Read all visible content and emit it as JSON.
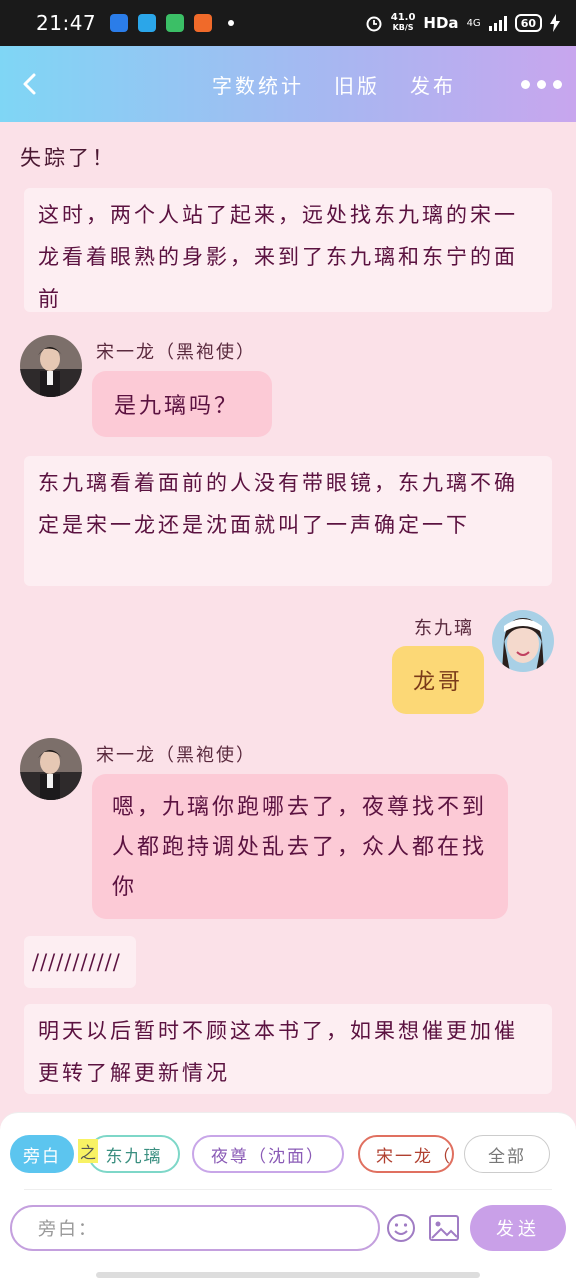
{
  "status_bar": {
    "time": "21:47",
    "net_speed": "41.0",
    "net_unit": "KB/S",
    "hd": "HDa",
    "network": "4G",
    "battery": "60"
  },
  "header": {
    "actions": [
      "字数统计",
      "旧版",
      "发布"
    ]
  },
  "messages": {
    "m0": "失踪了！",
    "m1": "这时，两个人站了起来，远处找东九璃的宋一龙看着眼熟的身影，来到了东九璃和东宁的面前",
    "m2_speaker": "宋一龙（黑袍使）",
    "m2_text": "是九璃吗？",
    "m3": "东九璃看着面前的人没有带眼镜，东九璃不确定是宋一龙还是沈面就叫了一声确定一下",
    "m4_speaker": "东九璃",
    "m4_text": "龙哥",
    "m5_speaker": "宋一龙（黑袍使）",
    "m5_text": "嗯，九璃你跑哪去了，夜尊找不到人都跑持调处乱去了，众人都在找你",
    "m6": "///////////",
    "m7": "明天以后暂时不顾这本书了，如果想催更加催更转了解更新情况"
  },
  "composer": {
    "chips": {
      "self": "旁白",
      "zhi": "之",
      "ding": "东九璃",
      "ye": "夜尊（沈面）",
      "song": "宋一龙（黑",
      "all": "全部"
    },
    "placeholder": "旁白：",
    "send_label": "发送"
  },
  "colors": {
    "header_gradient_start": "#7fd6f5",
    "header_gradient_end": "#c8a6ee",
    "background": "#fbe1e8",
    "bubble_pink": "#fccad6",
    "bubble_yellow": "#fcd876",
    "send_button": "#c9a0e8"
  }
}
